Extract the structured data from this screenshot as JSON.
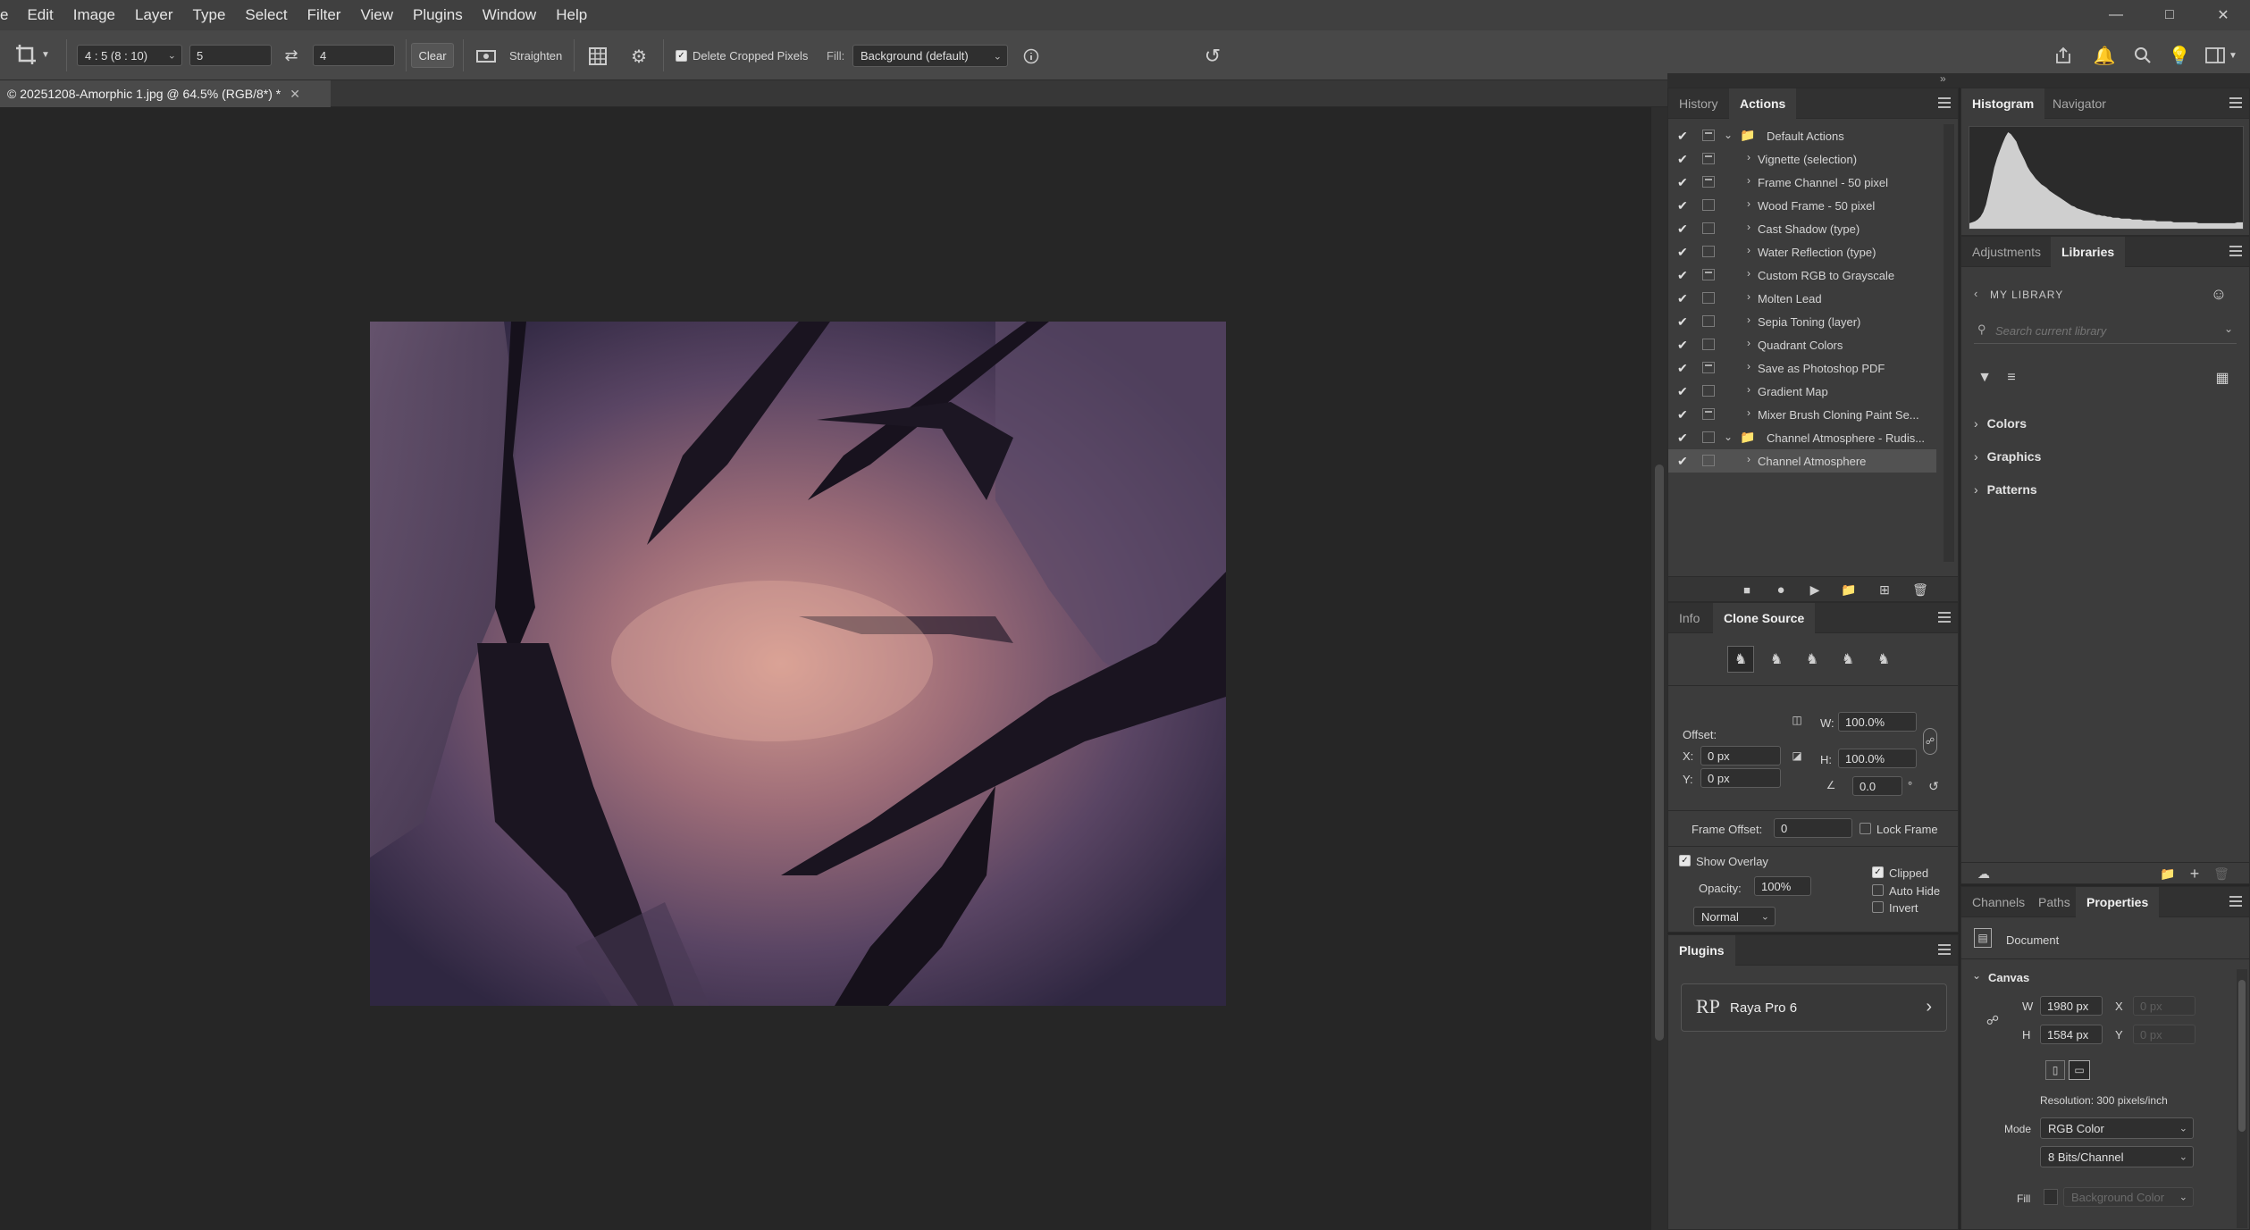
{
  "menu": [
    "e",
    "Edit",
    "Image",
    "Layer",
    "Type",
    "Select",
    "Filter",
    "View",
    "Plugins",
    "Window",
    "Help"
  ],
  "options": {
    "ratio_preset": "4 : 5 (8 : 10)",
    "ratio_w": "5",
    "ratio_h": "4",
    "clear_label": "Clear",
    "straighten_label": "Straighten",
    "delete_cropped_label": "Delete Cropped Pixels",
    "fill_label": "Fill:",
    "fill_value": "Background (default)"
  },
  "document_tab": {
    "title": "© 20251208-Amorphic 1.jpg @ 64.5% (RGB/8*) *"
  },
  "actions_panel": {
    "tabs": [
      "History",
      "Actions"
    ],
    "active_tab": "Actions",
    "items": [
      {
        "name": "Default Actions",
        "kind": "set",
        "dialog": true
      },
      {
        "name": "Vignette (selection)",
        "kind": "action",
        "dialog": true
      },
      {
        "name": "Frame Channel - 50 pixel",
        "kind": "action",
        "dialog": true
      },
      {
        "name": "Wood Frame - 50 pixel",
        "kind": "action",
        "dialog": false
      },
      {
        "name": "Cast Shadow (type)",
        "kind": "action",
        "dialog": false
      },
      {
        "name": "Water Reflection (type)",
        "kind": "action",
        "dialog": false
      },
      {
        "name": "Custom RGB to Grayscale",
        "kind": "action",
        "dialog": true
      },
      {
        "name": "Molten Lead",
        "kind": "action",
        "dialog": false
      },
      {
        "name": "Sepia Toning (layer)",
        "kind": "action",
        "dialog": false
      },
      {
        "name": "Quadrant Colors",
        "kind": "action",
        "dialog": false
      },
      {
        "name": "Save as Photoshop PDF",
        "kind": "action",
        "dialog": true
      },
      {
        "name": "Gradient Map",
        "kind": "action",
        "dialog": false
      },
      {
        "name": "Mixer Brush Cloning Paint Se...",
        "kind": "action",
        "dialog": true
      },
      {
        "name": "Channel Atmosphere - Rudis...",
        "kind": "set",
        "dialog": false
      },
      {
        "name": "Channel Atmosphere",
        "kind": "action",
        "dialog": false,
        "selected": true
      }
    ]
  },
  "clone_panel": {
    "tabs": [
      "Info",
      "Clone Source"
    ],
    "offset_label": "Offset:",
    "x_label": "X:",
    "x_value": "0 px",
    "y_label": "Y:",
    "y_value": "0 px",
    "w_label": "W:",
    "w_value": "100.0%",
    "h_label": "H:",
    "h_value": "100.0%",
    "angle_value": "0.0",
    "degree": "°",
    "frame_offset_label": "Frame Offset:",
    "frame_offset_value": "0",
    "lock_frame_label": "Lock Frame",
    "show_overlay_label": "Show Overlay",
    "opacity_label": "Opacity:",
    "opacity_value": "100%",
    "blend_mode": "Normal",
    "clipped_label": "Clipped",
    "auto_hide_label": "Auto Hide",
    "invert_label": "Invert"
  },
  "plugins_panel": {
    "title": "Plugins",
    "plugin_name": "Raya Pro 6",
    "plugin_logo": "RP"
  },
  "histogram_panel": {
    "tabs": [
      "Histogram",
      "Navigator"
    ]
  },
  "libraries_panel": {
    "tabs": [
      "Adjustments",
      "Libraries"
    ],
    "library_name": "MY LIBRARY",
    "search_placeholder": "Search current library",
    "sections": [
      "Colors",
      "Graphics",
      "Patterns"
    ]
  },
  "properties_panel": {
    "tabs": [
      "Channels",
      "Paths",
      "Properties"
    ],
    "document_label": "Document",
    "canvas_label": "Canvas",
    "w_label": "W",
    "w_value": "1980 px",
    "h_label": "H",
    "h_value": "1584 px",
    "x_label": "X",
    "x_placeholder": "0 px",
    "y_label": "Y",
    "y_placeholder": "0 px",
    "resolution": "Resolution: 300 pixels/inch",
    "mode_label": "Mode",
    "mode_value": "RGB Color",
    "depth_value": "8 Bits/Channel",
    "fill_label": "Fill",
    "fill_value": "Background Color"
  },
  "histogram_values": [
    2,
    3,
    4,
    6,
    9,
    14,
    22,
    35,
    48,
    62,
    72,
    80,
    88,
    95,
    100,
    98,
    94,
    90,
    82,
    76,
    70,
    63,
    58,
    54,
    50,
    47,
    44,
    42,
    40,
    37,
    35,
    33,
    31,
    29,
    27,
    25,
    23,
    21,
    20,
    18,
    17,
    16,
    15,
    14,
    13,
    12,
    11,
    11,
    10,
    10,
    9,
    9,
    8,
    8,
    8,
    7,
    7,
    7,
    7,
    6,
    6,
    6,
    6,
    5,
    5,
    5,
    5,
    5,
    4,
    4,
    4,
    4,
    4,
    4,
    3,
    3,
    3,
    3,
    3,
    3,
    3,
    3,
    3,
    2,
    2,
    2,
    2,
    2,
    2,
    2,
    2,
    2,
    2,
    2,
    2,
    2,
    2,
    3,
    3,
    3
  ]
}
